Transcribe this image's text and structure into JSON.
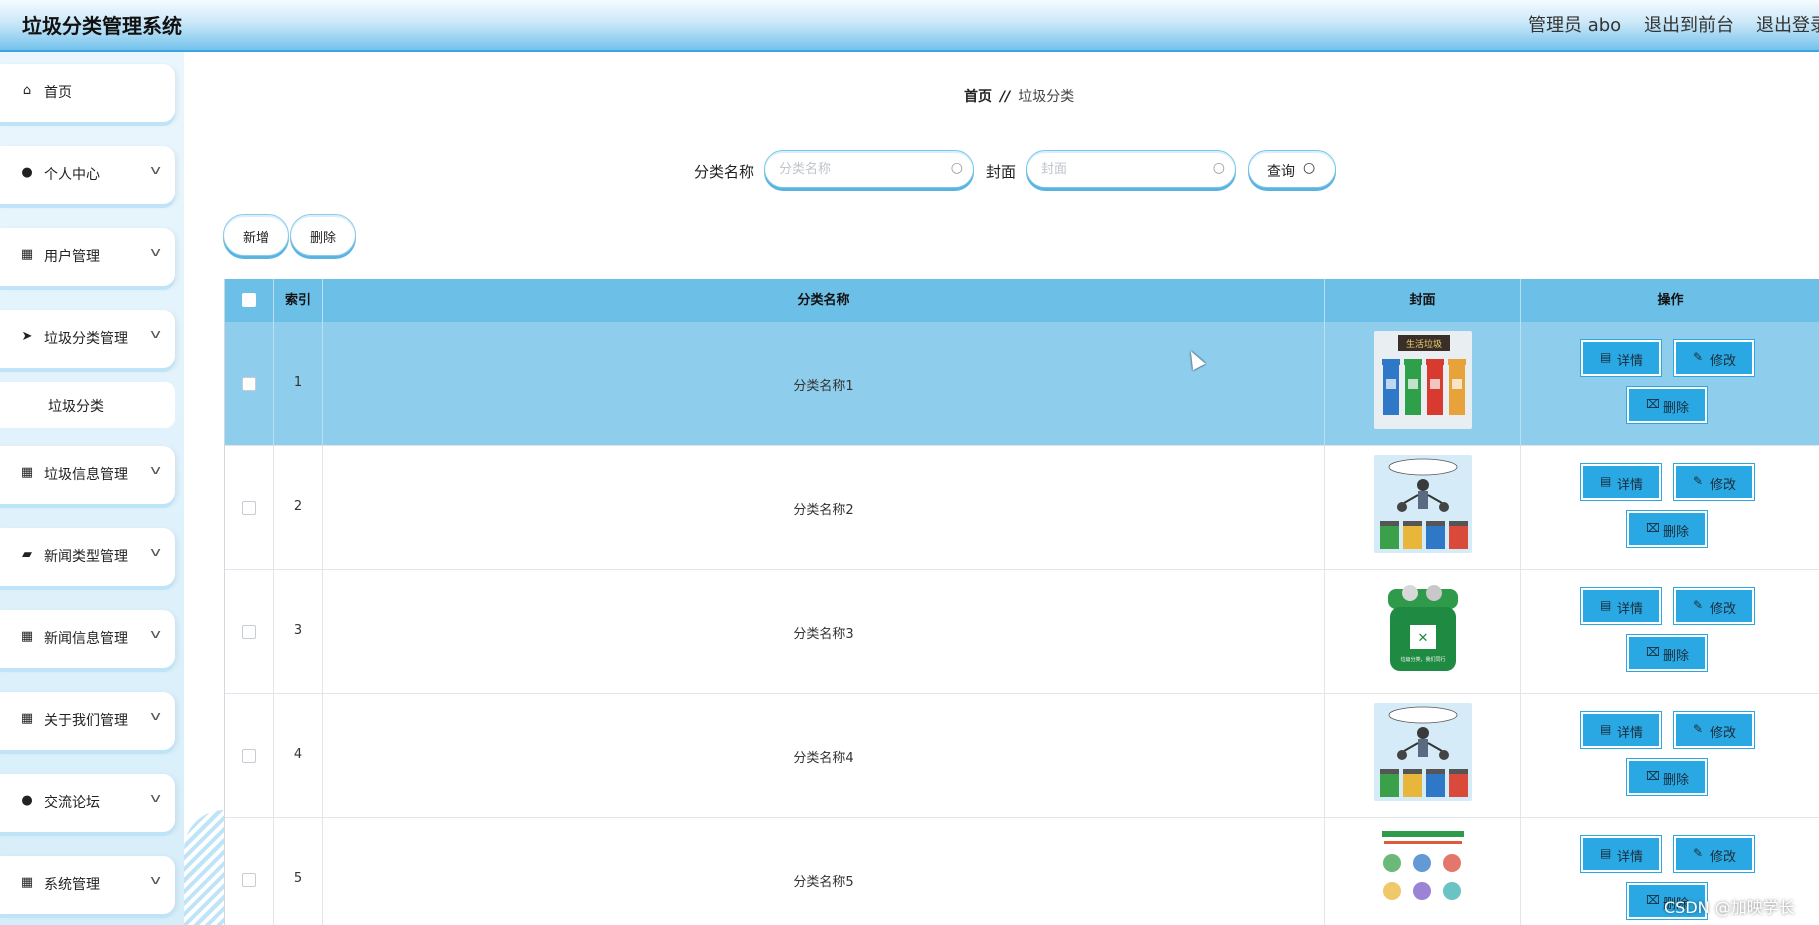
{
  "header": {
    "title": "垃圾分类管理系统",
    "user": "管理员 abo",
    "front_link": "退出到前台",
    "logout_link": "退出登录"
  },
  "sidebar": {
    "items": [
      {
        "label": "首页",
        "icon": "home-icon",
        "has_children": false
      },
      {
        "label": "个人中心",
        "icon": "person-icon",
        "has_children": true
      },
      {
        "label": "用户管理",
        "icon": "grid-icon",
        "has_children": true
      },
      {
        "label": "垃圾分类管理",
        "icon": "paper-plane-icon",
        "has_children": true
      },
      {
        "label": "垃圾信息管理",
        "icon": "grid-icon",
        "has_children": true
      },
      {
        "label": "新闻类型管理",
        "icon": "ticket-icon",
        "has_children": true
      },
      {
        "label": "新闻信息管理",
        "icon": "grid-icon",
        "has_children": true
      },
      {
        "label": "关于我们管理",
        "icon": "grid-icon",
        "has_children": true
      },
      {
        "label": "交流论坛",
        "icon": "person-icon",
        "has_children": true
      },
      {
        "label": "系统管理",
        "icon": "grid-icon",
        "has_children": true
      }
    ],
    "subitem": "垃圾分类"
  },
  "breadcrumb": {
    "home": "首页",
    "separator": "//",
    "current": "垃圾分类"
  },
  "search": {
    "name_label": "分类名称",
    "name_placeholder": "分类名称",
    "name_value": "",
    "cover_label": "封面",
    "cover_placeholder": "封面",
    "cover_value": "",
    "query_label": "查询"
  },
  "actions": {
    "add_label": "新增",
    "delete_label": "删除"
  },
  "table": {
    "columns": [
      "",
      "索引",
      "分类名称",
      "封面",
      "操作"
    ],
    "rows": [
      {
        "index": "1",
        "name": "分类名称1",
        "cover": "trash-bins-cover",
        "selected": true
      },
      {
        "index": "2",
        "name": "分类名称2",
        "cover": "sorting-person-cover",
        "selected": false
      },
      {
        "index": "3",
        "name": "分类名称3",
        "cover": "green-bin-cover",
        "selected": false
      },
      {
        "index": "4",
        "name": "分类名称4",
        "cover": "sorting-person-cover",
        "selected": false
      },
      {
        "index": "5",
        "name": "分类名称5",
        "cover": "poster-cover",
        "selected": false
      }
    ],
    "row_actions": {
      "detail": "详情",
      "edit": "修改",
      "delete": "删除"
    },
    "cover_caption_1": "生活垃圾",
    "cover_caption_2": "垃圾分类，我们同行"
  },
  "colors": {
    "accent": "#2aa8e3",
    "header_bar": "#6cc0e8",
    "selected_row": "#8fcdec"
  },
  "watermark": "CSDN @加映学长"
}
